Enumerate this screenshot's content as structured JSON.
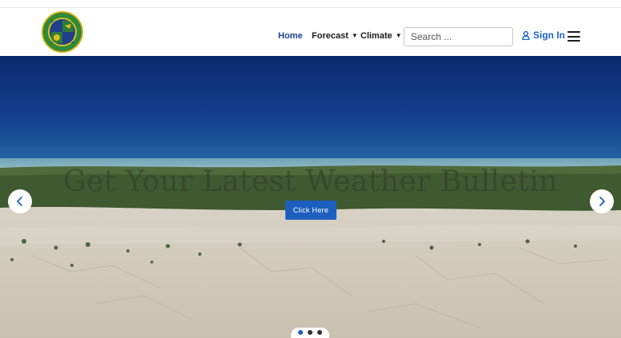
{
  "nav": {
    "home": "Home",
    "forecast": "Forecast",
    "climate": "Climate"
  },
  "search": {
    "placeholder": "Search ..."
  },
  "account": {
    "signin": "Sign In"
  },
  "hero": {
    "title": "Get Your Latest Weather Bulletin",
    "cta": "Click Here",
    "slides": 3,
    "active_slide": 1
  },
  "colors": {
    "accent": "#1c63c9",
    "cta": "#1d5fbe",
    "nav_active": "#1c3f91"
  },
  "icons": [
    "logo-emblem",
    "chevron-down-icon",
    "user-icon",
    "menu-icon",
    "chevron-left-icon",
    "chevron-right-icon"
  ]
}
